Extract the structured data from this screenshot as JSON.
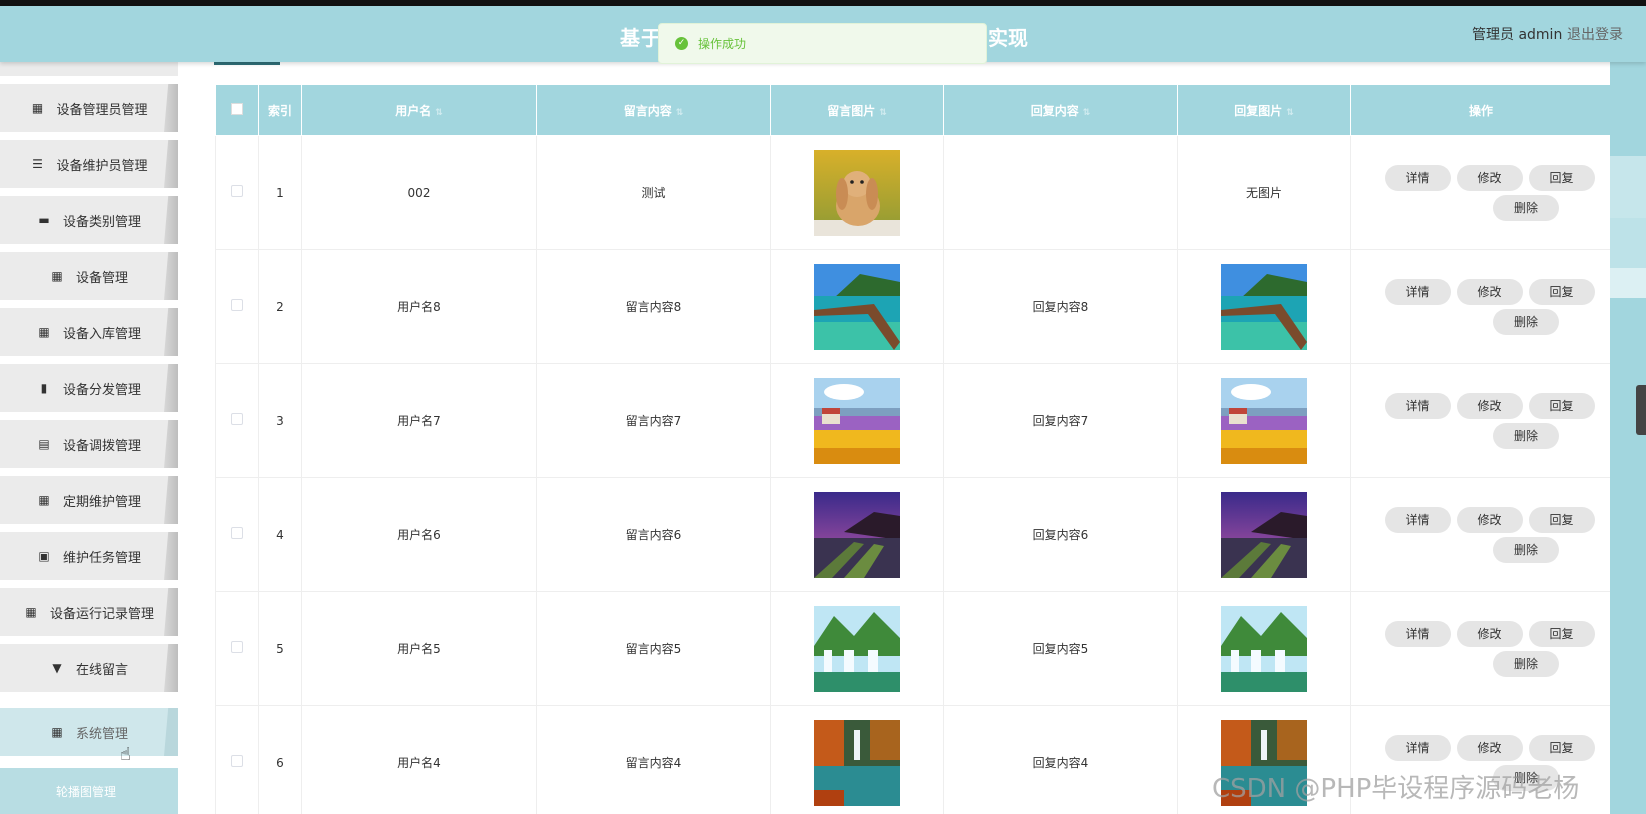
{
  "header": {
    "title_left": "基于",
    "title_right": "实现",
    "admin": "管理员 admin",
    "logout": "退出登录"
  },
  "toast": {
    "message": "操作成功",
    "icon": "check-circle-icon",
    "color": "#67c23a"
  },
  "sidebar": {
    "items": [
      {
        "label": "设备管理员管理",
        "icon": "grid-icon"
      },
      {
        "label": "设备维护员管理",
        "icon": "list-icon"
      },
      {
        "label": "设备类别管理",
        "icon": "monitor-icon"
      },
      {
        "label": "设备管理",
        "icon": "grid-icon"
      },
      {
        "label": "设备入库管理",
        "icon": "grid-icon"
      },
      {
        "label": "设备分发管理",
        "icon": "chart-icon"
      },
      {
        "label": "设备调拨管理",
        "icon": "clipboard-icon"
      },
      {
        "label": "定期维护管理",
        "icon": "grid-icon"
      },
      {
        "label": "维护任务管理",
        "icon": "clipboard-check-icon"
      },
      {
        "label": "设备运行记录管理",
        "icon": "grid-icon"
      },
      {
        "label": "在线留言",
        "icon": "pin-icon"
      },
      {
        "label": "系统管理",
        "icon": "grid-icon"
      }
    ],
    "sub_item": "轮播图管理"
  },
  "table": {
    "headers": [
      "索引",
      "用户名",
      "留言内容",
      "留言图片",
      "回复内容",
      "回复图片",
      "操作"
    ],
    "rows": [
      {
        "index": "1",
        "username": "002",
        "content": "测试",
        "reply": "",
        "reply_image_text": "无图片",
        "image": "rabbit"
      },
      {
        "index": "2",
        "username": "用户名8",
        "content": "留言内容8",
        "reply": "回复内容8",
        "reply_image_text": "",
        "image": "pier"
      },
      {
        "index": "3",
        "username": "用户名7",
        "content": "留言内容7",
        "reply": "回复内容7",
        "reply_image_text": "",
        "image": "field"
      },
      {
        "index": "4",
        "username": "用户名6",
        "content": "留言内容6",
        "reply": "回复内容6",
        "reply_image_text": "",
        "image": "dusk"
      },
      {
        "index": "5",
        "username": "用户名5",
        "content": "留言内容5",
        "reply": "回复内容5",
        "reply_image_text": "",
        "image": "waterfall"
      },
      {
        "index": "6",
        "username": "用户名4",
        "content": "留言内容4",
        "reply": "回复内容4",
        "reply_image_text": "",
        "image": "autumn"
      }
    ],
    "actions": {
      "detail": "详情",
      "edit": "修改",
      "reply": "回复",
      "delete": "删除"
    }
  },
  "watermark": "CSDN @PHP毕设程序源码老杨",
  "colors": {
    "theme": "#a2d6de",
    "sidebar_item": "#ebebeb",
    "button": "#e5e5e5"
  }
}
